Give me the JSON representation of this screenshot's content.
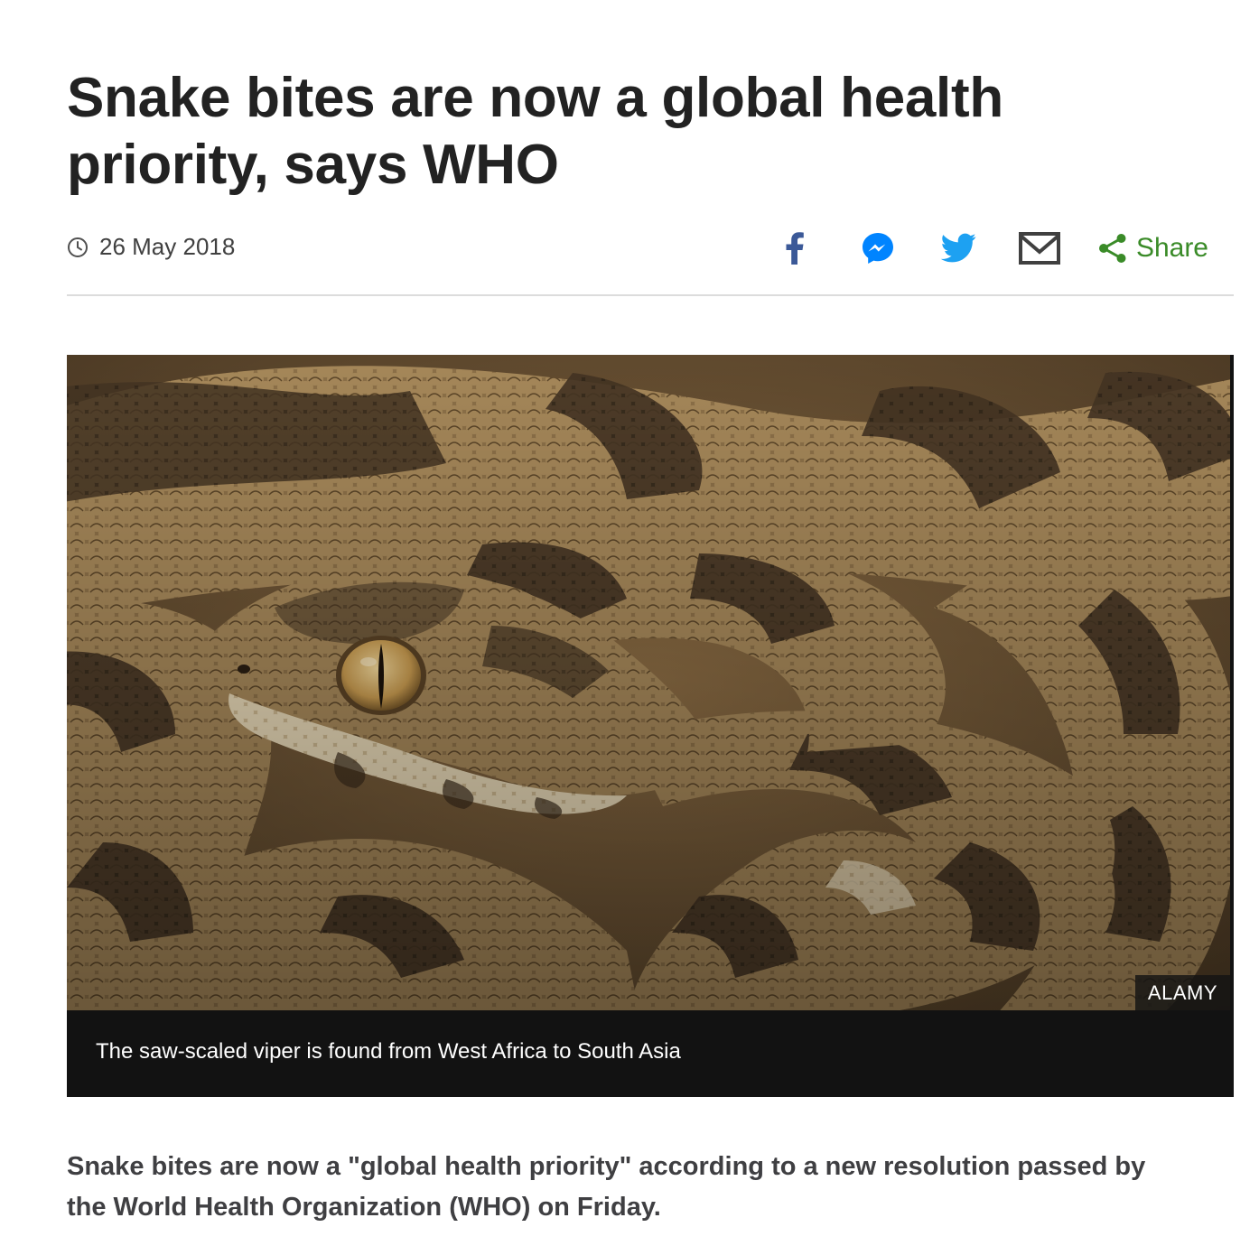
{
  "article": {
    "headline": "Snake bites are now a global health priority, says WHO",
    "date": "26 May 2018",
    "share": {
      "facebook_icon": "facebook-icon",
      "messenger_icon": "messenger-icon",
      "twitter_icon": "twitter-icon",
      "email_icon": "email-icon",
      "share_label": "Share",
      "share_color": "#3a8b28"
    },
    "figure": {
      "credit": "ALAMY",
      "caption": "The saw-scaled viper is found from West Africa to South Asia"
    },
    "intro": "Snake bites are now a \"global health priority\" according to a new resolution passed by the World Health Organization (WHO) on Friday."
  },
  "colors": {
    "text": "#222222",
    "caption_bg": "#121212",
    "facebook": "#3b5998",
    "messenger": "#0084ff",
    "twitter": "#1da1f2",
    "email": "#404040"
  }
}
